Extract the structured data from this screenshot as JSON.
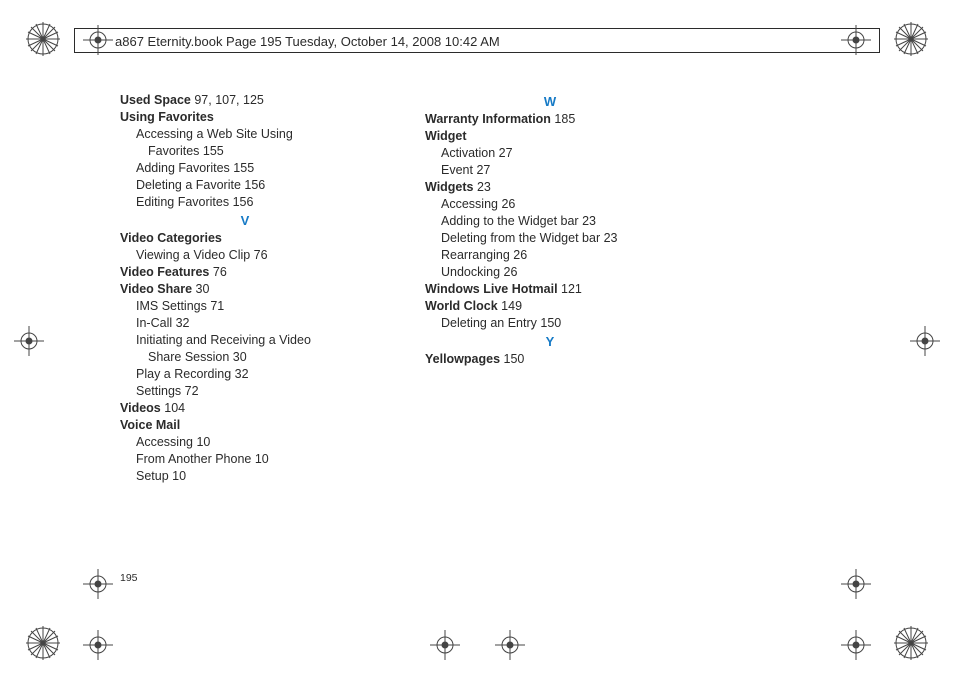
{
  "header": {
    "text": "a867 Eternity.book  Page 195  Tuesday, October 14, 2008  10:42 AM"
  },
  "page_number": "195",
  "left_column": {
    "used_space": {
      "term": "Used Space",
      "pages": " 97, 107, 125"
    },
    "using_favorites": {
      "term": "Using Favorites",
      "sub1a": "Accessing a Web Site Using",
      "sub1b": "Favorites",
      "sub1b_pg": " 155",
      "sub2": "Adding Favorites",
      "sub2_pg": " 155",
      "sub3": "Deleting a Favorite",
      "sub3_pg": " 156",
      "sub4": "Editing Favorites",
      "sub4_pg": " 156"
    },
    "letter_v": "V",
    "video_categories": {
      "term": "Video Categories",
      "sub1": "Viewing a Video Clip",
      "sub1_pg": " 76"
    },
    "video_features": {
      "term": "Video Features",
      "pages": " 76"
    },
    "video_share": {
      "term": "Video Share",
      "pages": " 30",
      "sub1": "IMS Settings",
      "sub1_pg": " 71",
      "sub2": "In-Call",
      "sub2_pg": " 32",
      "sub3a": "Initiating and Receiving a Video",
      "sub3b": "Share Session",
      "sub3b_pg": " 30",
      "sub4": "Play a Recording",
      "sub4_pg": " 32",
      "sub5": "Settings",
      "sub5_pg": " 72"
    },
    "videos": {
      "term": "Videos",
      "pages": " 104"
    },
    "voice_mail": {
      "term": "Voice Mail",
      "sub1": "Accessing",
      "sub1_pg": " 10",
      "sub2": "From Another Phone",
      "sub2_pg": " 10",
      "sub3": "Setup",
      "sub3_pg": " 10"
    }
  },
  "right_column": {
    "letter_w": "W",
    "warranty": {
      "term": "Warranty Information",
      "pages": " 185"
    },
    "widget": {
      "term": "Widget",
      "sub1": "Activation",
      "sub1_pg": " 27",
      "sub2": "Event",
      "sub2_pg": " 27"
    },
    "widgets": {
      "term": "Widgets",
      "pages": " 23",
      "sub1": "Accessing",
      "sub1_pg": " 26",
      "sub2": "Adding to the Widget bar",
      "sub2_pg": " 23",
      "sub3": "Deleting from the Widget bar",
      "sub3_pg": " 23",
      "sub4": "Rearranging",
      "sub4_pg": " 26",
      "sub5": "Undocking",
      "sub5_pg": " 26"
    },
    "wlh": {
      "term": "Windows Live Hotmail",
      "pages": " 121"
    },
    "world_clock": {
      "term": "World Clock",
      "pages": " 149",
      "sub1": "Deleting an Entry",
      "sub1_pg": " 150"
    },
    "letter_y": "Y",
    "yellowpages": {
      "term": "Yellowpages",
      "pages": " 150"
    }
  }
}
